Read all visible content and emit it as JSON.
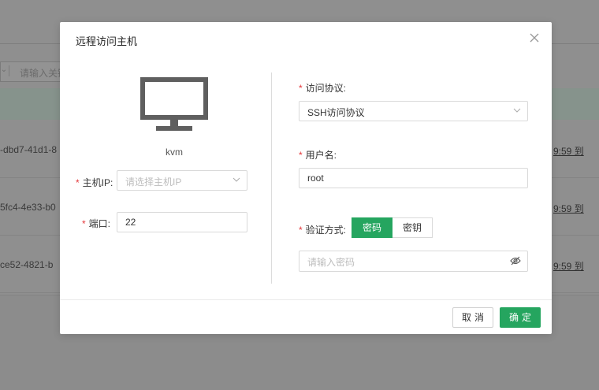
{
  "background": {
    "filter_placeholder": "请输入关键",
    "rows": [
      {
        "id": "-dbd7-41d1-8",
        "time": "9:59 到"
      },
      {
        "id": "5fc4-4e33-b0",
        "time": "9:59 到"
      },
      {
        "id": "ce52-4821-b",
        "time": "9:59 到"
      }
    ]
  },
  "dialog": {
    "title": "远程访问主机",
    "host_name": "kvm",
    "required_mark": "*",
    "host_ip": {
      "label": "主机IP:",
      "placeholder": "请选择主机IP"
    },
    "port": {
      "label": "端口:",
      "value": "22"
    },
    "protocol": {
      "label": "访问协议:",
      "value": "SSH访问协议"
    },
    "username": {
      "label": "用户名:",
      "value": "root"
    },
    "auth": {
      "label": "验证方式:",
      "options": [
        "密码",
        "密钥"
      ],
      "selected": "密码"
    },
    "password": {
      "placeholder": "请输入密码"
    },
    "cancel_label": "取消",
    "ok_label": "确定"
  },
  "colors": {
    "accent": "#25a55f",
    "required": "#e4393c"
  }
}
